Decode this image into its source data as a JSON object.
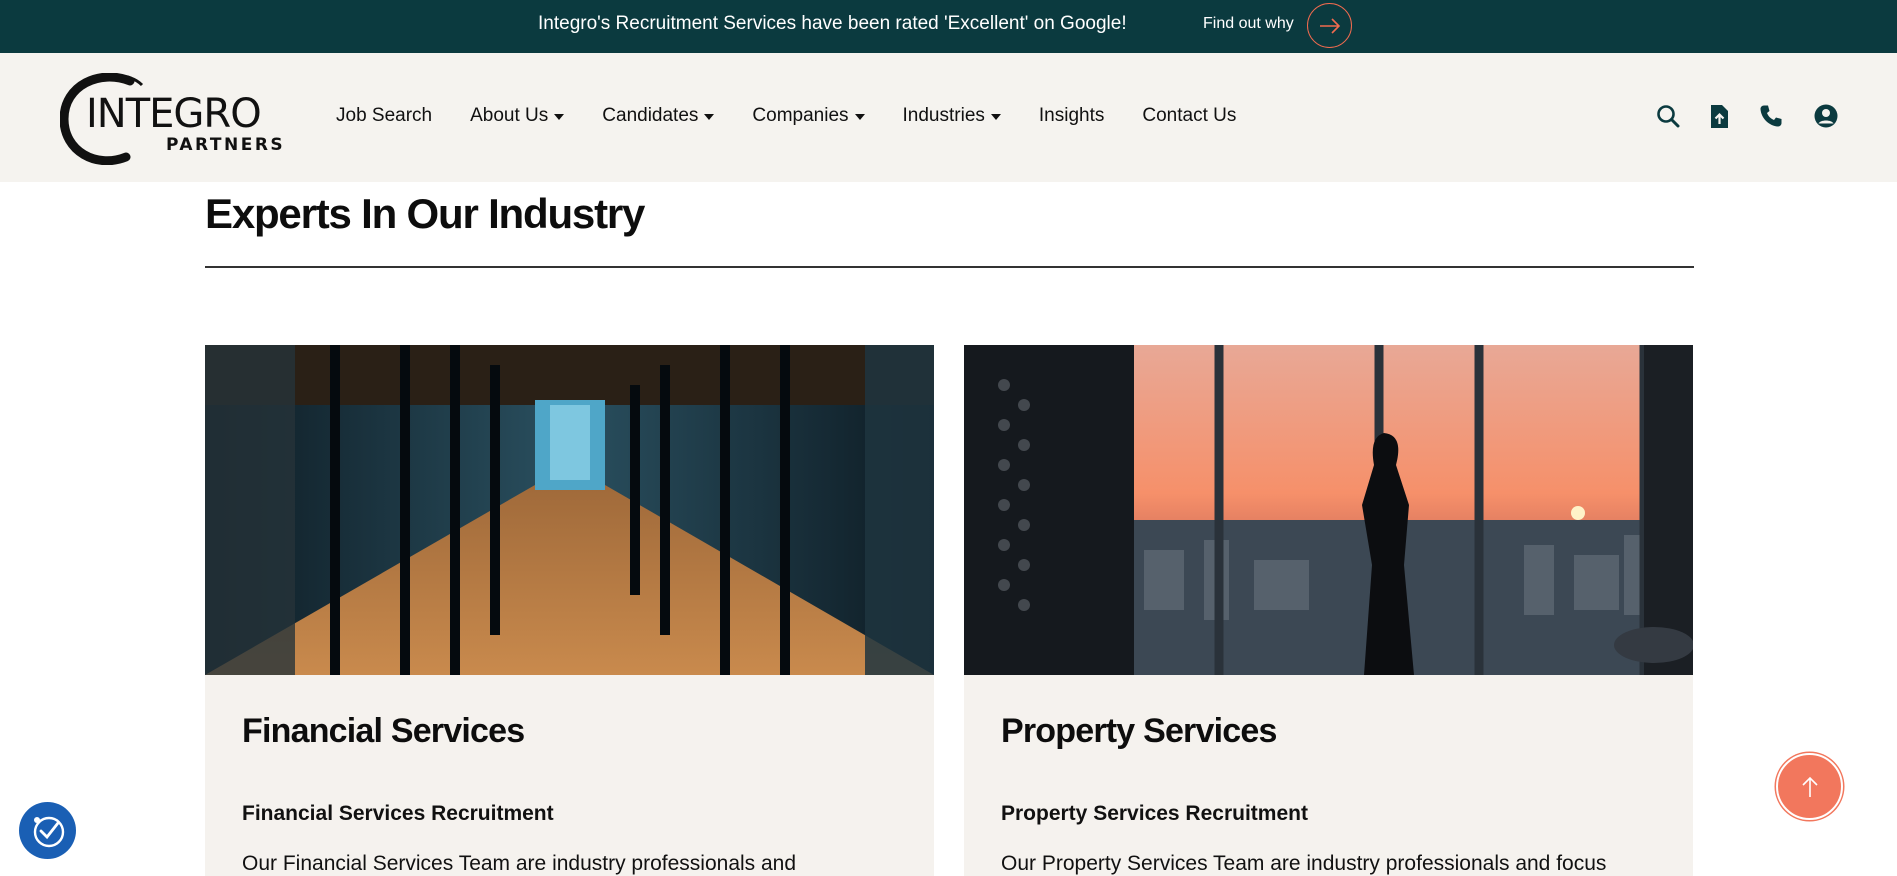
{
  "announcement": {
    "text": "Integro's Recruitment Services have been rated 'Excellent' on Google!",
    "link_label": "Find out why"
  },
  "logo": {
    "word": "INTEGRO",
    "sub": "PARTNERS"
  },
  "nav": {
    "items": [
      {
        "label": "Job Search",
        "dropdown": false
      },
      {
        "label": "About Us",
        "dropdown": true
      },
      {
        "label": "Candidates",
        "dropdown": true
      },
      {
        "label": "Companies",
        "dropdown": true
      },
      {
        "label": "Industries",
        "dropdown": true
      },
      {
        "label": "Insights",
        "dropdown": false
      },
      {
        "label": "Contact Us",
        "dropdown": false
      }
    ],
    "icons": [
      "search-icon",
      "upload-cv-icon",
      "phone-icon",
      "account-icon"
    ]
  },
  "main": {
    "section_title": "Experts In Our Industry",
    "cards": [
      {
        "title": "Financial Services",
        "subtitle": "Financial Services Recruitment",
        "body": "Our Financial Services Team are industry professionals and"
      },
      {
        "title": "Property Services",
        "subtitle": "Property Services Recruitment",
        "body": "Our Property Services Team are industry professionals and focus"
      }
    ]
  },
  "colors": {
    "topbar_bg": "#0b3a3f",
    "header_bg": "#f5f3ef",
    "card_bg": "#f5f2ee",
    "accent": "#f2775d",
    "a11y_button": "#1a5fb4"
  }
}
